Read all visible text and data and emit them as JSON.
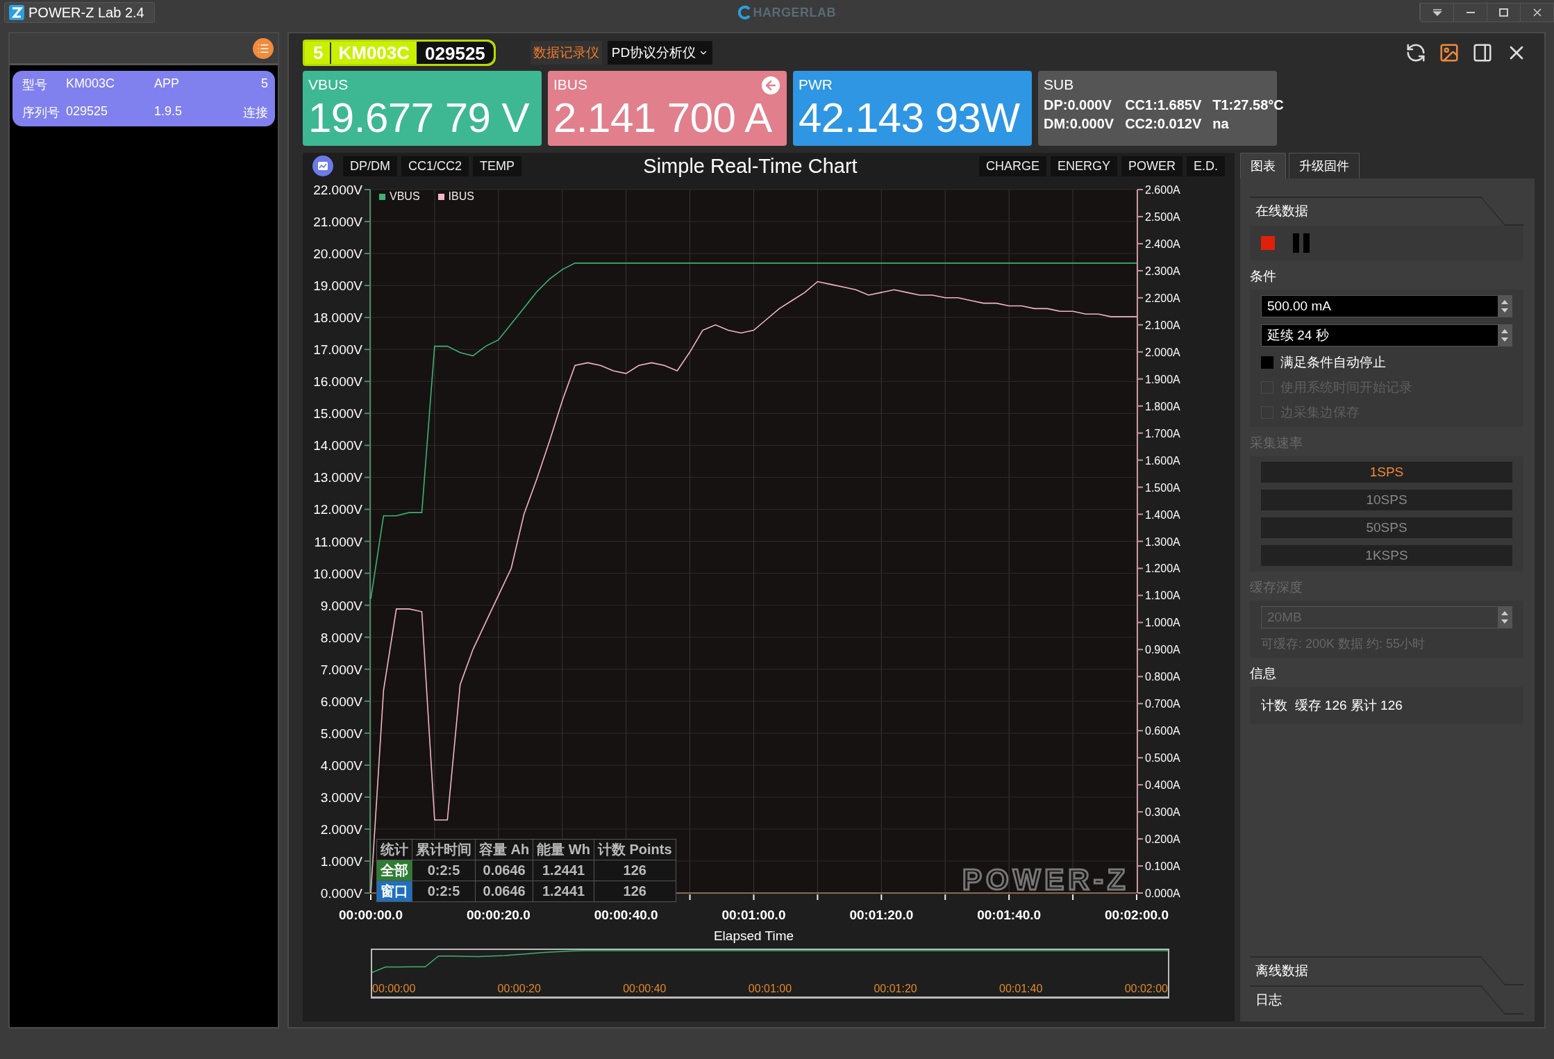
{
  "window": {
    "title": "POWER-Z Lab 2.4",
    "brand": "HARGERLAB"
  },
  "device_list": [
    {
      "selected": true,
      "rows": [
        [
          "型号",
          "KM003C",
          "APP",
          "5"
        ],
        [
          "序列号",
          "029525",
          "1.9.5",
          "连接"
        ]
      ]
    }
  ],
  "device_badge": {
    "channel": "5",
    "model": "KM003C",
    "serial": "029525"
  },
  "modes": [
    {
      "label": "数据记录仪",
      "selected": true
    }
  ],
  "analyzer_dropdown": "PD协议分析仪",
  "meters": [
    {
      "kind": "vbus",
      "label": "VBUS",
      "value": "19.677 79 V"
    },
    {
      "kind": "ibus",
      "label": "IBUS",
      "value": "2.141 700 A"
    },
    {
      "kind": "pwr",
      "label": "PWR",
      "value": "42.143 93W"
    },
    {
      "kind": "sub",
      "label": "SUB",
      "lines": [
        [
          "DP:0.000V",
          "CC1:1.685V",
          "T1:27.58°C"
        ],
        [
          "DM:0.000V",
          "CC2:0.012V",
          "na"
        ]
      ]
    }
  ],
  "chart": {
    "left_tabs": [
      "DP/DM",
      "CC1/CC2",
      "TEMP"
    ],
    "right_tabs": [
      "CHARGE",
      "ENERGY",
      "POWER",
      "E.D."
    ],
    "watermark": "POWER-Z",
    "stats": {
      "columns": [
        "统计",
        "累计时间",
        "容量 Ah",
        "能量 Wh",
        "计数 Points"
      ],
      "rows": [
        {
          "color": "#2e7d32",
          "cells": [
            "全部",
            "0:2:5",
            "0.0646",
            "1.2441",
            "126"
          ]
        },
        {
          "color": "#1f6fbf",
          "cells": [
            "窗口",
            "0:2:5",
            "0.0646",
            "1.2441",
            "126"
          ]
        }
      ]
    },
    "overview_ticks": [
      "00:00:00",
      "00:00:20",
      "00:00:40",
      "00:01:00",
      "00:01:20",
      "00:01:40",
      "00:02:00"
    ],
    "chart_data": {
      "type": "line",
      "title": "Simple Real-Time Chart",
      "xlabel": "Elapsed Time",
      "grid": true,
      "categories": [
        "00:00:00.0",
        null,
        null,
        null,
        null,
        null,
        null,
        null,
        null,
        null,
        "00:00:20.0",
        null,
        null,
        null,
        null,
        null,
        null,
        null,
        null,
        null,
        "00:00:40.0",
        null,
        null,
        null,
        null,
        null,
        null,
        null,
        null,
        null,
        "00:01:00.0",
        null,
        null,
        null,
        null,
        null,
        null,
        null,
        null,
        null,
        "00:01:20.0",
        null,
        null,
        null,
        null,
        null,
        null,
        null,
        null,
        null,
        "00:01:40.0",
        null,
        null,
        null,
        null,
        null,
        null,
        null,
        null,
        null,
        "00:02:00.0"
      ],
      "series": [
        {
          "name": "VBUS",
          "color": "#3cb371",
          "values": [
            9.2,
            11.8,
            11.8,
            11.9,
            11.9,
            17.1,
            17.1,
            16.9,
            16.8,
            17.1,
            17.3,
            17.8,
            18.3,
            18.8,
            19.2,
            19.5,
            19.7,
            19.7,
            19.7,
            19.7,
            19.7,
            19.7,
            19.7,
            19.7,
            19.7,
            19.7,
            19.7,
            19.7,
            19.7,
            19.7,
            19.7,
            19.7,
            19.7,
            19.7,
            19.7,
            19.7,
            19.7,
            19.7,
            19.7,
            19.7,
            19.7,
            19.7,
            19.7,
            19.7,
            19.7,
            19.7,
            19.7,
            19.7,
            19.7,
            19.7,
            19.7,
            19.7,
            19.7,
            19.7,
            19.7,
            19.7,
            19.7,
            19.7,
            19.7,
            19.7,
            19.7
          ]
        },
        {
          "name": "IBUS",
          "color": "#f4b6c2",
          "axis": "y2",
          "values": [
            0.0,
            0.75,
            1.05,
            1.05,
            1.04,
            0.27,
            0.27,
            0.77,
            0.9,
            1.0,
            1.1,
            1.2,
            1.4,
            1.53,
            1.67,
            1.82,
            1.95,
            1.96,
            1.95,
            1.93,
            1.92,
            1.95,
            1.96,
            1.95,
            1.93,
            2.0,
            2.08,
            2.1,
            2.08,
            2.07,
            2.08,
            2.12,
            2.16,
            2.19,
            2.22,
            2.26,
            2.25,
            2.24,
            2.23,
            2.21,
            2.22,
            2.23,
            2.22,
            2.21,
            2.21,
            2.2,
            2.2,
            2.19,
            2.18,
            2.18,
            2.17,
            2.17,
            2.16,
            2.16,
            2.15,
            2.15,
            2.14,
            2.14,
            2.13,
            2.13,
            2.13
          ]
        }
      ],
      "ylim": [
        0,
        22
      ],
      "y2lim": [
        0,
        2.6
      ],
      "yticks": [
        {
          "value": 22,
          "label": "22.000V"
        },
        {
          "value": 21,
          "label": "21.000V"
        },
        {
          "value": 20,
          "label": "20.000V"
        },
        {
          "value": 19,
          "label": "19.000V"
        },
        {
          "value": 18,
          "label": "18.000V"
        },
        {
          "value": 17,
          "label": "17.000V"
        },
        {
          "value": 16,
          "label": "16.000V"
        },
        {
          "value": 15,
          "label": "15.000V"
        },
        {
          "value": 14,
          "label": "14.000V"
        },
        {
          "value": 13,
          "label": "13.000V"
        },
        {
          "value": 12,
          "label": "12.000V"
        },
        {
          "value": 11,
          "label": "11.000V"
        },
        {
          "value": 10,
          "label": "10.000V"
        },
        {
          "value": 9,
          "label": "9.000V"
        },
        {
          "value": 8,
          "label": "8.000V"
        },
        {
          "value": 7,
          "label": "7.000V"
        },
        {
          "value": 6,
          "label": "6.000V"
        },
        {
          "value": 5,
          "label": "5.000V"
        },
        {
          "value": 4,
          "label": "4.000V"
        },
        {
          "value": 3,
          "label": "3.000V"
        },
        {
          "value": 2,
          "label": "2.000V"
        },
        {
          "value": 1,
          "label": "1.000V"
        },
        {
          "value": 0,
          "label": "0.000V"
        }
      ],
      "y2ticks": [
        {
          "value": 2.6,
          "label": "2.600A"
        },
        {
          "value": 2.5,
          "label": "2.500A"
        },
        {
          "value": 2.4,
          "label": "2.400A"
        },
        {
          "value": 2.3,
          "label": "2.300A"
        },
        {
          "value": 2.2,
          "label": "2.200A"
        },
        {
          "value": 2.1,
          "label": "2.100A"
        },
        {
          "value": 2.0,
          "label": "2.000A"
        },
        {
          "value": 1.9,
          "label": "1.900A"
        },
        {
          "value": 1.8,
          "label": "1.800A"
        },
        {
          "value": 1.7,
          "label": "1.700A"
        },
        {
          "value": 1.6,
          "label": "1.600A"
        },
        {
          "value": 1.5,
          "label": "1.500A"
        },
        {
          "value": 1.4,
          "label": "1.400A"
        },
        {
          "value": 1.3,
          "label": "1.300A"
        },
        {
          "value": 1.2,
          "label": "1.200A"
        },
        {
          "value": 1.1,
          "label": "1.100A"
        },
        {
          "value": 1.0,
          "label": "1.000A"
        },
        {
          "value": 0.9,
          "label": "0.900A"
        },
        {
          "value": 0.8,
          "label": "0.800A"
        },
        {
          "value": 0.7,
          "label": "0.700A"
        },
        {
          "value": 0.6,
          "label": "0.600A"
        },
        {
          "value": 0.5,
          "label": "0.500A"
        },
        {
          "value": 0.4,
          "label": "0.400A"
        },
        {
          "value": 0.3,
          "label": "0.300A"
        },
        {
          "value": 0.2,
          "label": "0.200A"
        },
        {
          "value": 0.1,
          "label": "0.100A"
        },
        {
          "value": 0.0,
          "label": "0.000A"
        }
      ]
    }
  },
  "side_tabs": [
    {
      "label": "图表",
      "selected": true
    },
    {
      "label": "升级固件",
      "selected": false
    }
  ],
  "panel": {
    "online_header": "在线数据",
    "conditions_label": "条件",
    "spin_fields": [
      {
        "value": "500.00 mA",
        "disabled": false
      },
      {
        "value": "延续 24 秒",
        "disabled": false
      }
    ],
    "checkboxes": [
      {
        "label": "满足条件自动停止",
        "checked": false,
        "disabled": false
      },
      {
        "label": "使用系统时间开始记录",
        "checked": false,
        "disabled": true
      },
      {
        "label": "边采集边保存",
        "checked": false,
        "disabled": true
      }
    ],
    "rate_label": "采集速率",
    "rate_disabled": true,
    "rates": [
      {
        "label": "1SPS",
        "selected": true
      },
      {
        "label": "10SPS",
        "selected": false
      },
      {
        "label": "50SPS",
        "selected": false
      },
      {
        "label": "1KSPS",
        "selected": false
      }
    ],
    "buffer_label": "缓存深度",
    "buffer_field": {
      "value": "20MB",
      "disabled": true
    },
    "buffer_note": "可缓存: 200K 数据 约: 55小时",
    "info_label": "信息",
    "info_text": "计数  缓存 126 累计 126",
    "offline_header": "离线数据",
    "log_header": "日志"
  }
}
